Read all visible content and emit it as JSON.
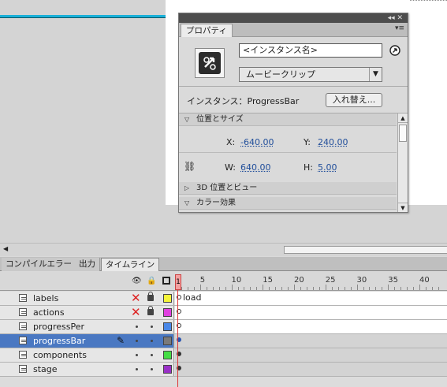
{
  "properties_panel": {
    "window_controls": "◂◂ ✕",
    "tab_label": "プロパティ",
    "menu_icon": "▾≡",
    "instance_name_placeholder": "<インスタンス名>",
    "symbol_type": "ムービークリップ",
    "instance_label": "インスタンス：ProgressBar",
    "swap_button": "入れ替え...",
    "position_size": {
      "title": "位置とサイズ",
      "x_label": "X:",
      "x_value": "-640.00",
      "y_label": "Y:",
      "y_value": "240.00",
      "w_label": "W:",
      "w_value": "640.00",
      "h_label": "H:",
      "h_value": "5.00"
    },
    "section_3d": "3D 位置とビュー",
    "section_color": "カラー効果"
  },
  "bottom_tabs": [
    "コンパイルエラー",
    "出力",
    "タイムライン"
  ],
  "timeline": {
    "frame_numbers": [
      "1",
      "5",
      "10",
      "15",
      "20",
      "25",
      "30",
      "35",
      "40"
    ],
    "current_frame": "1",
    "layers": [
      {
        "name": "labels",
        "color": "#f5f53a",
        "hidden": true,
        "locked": true,
        "frame_label": "load"
      },
      {
        "name": "actions",
        "color": "#e040e0",
        "hidden": true,
        "locked": true,
        "frame_label": ""
      },
      {
        "name": "progressPer",
        "color": "#4a88e8",
        "hidden": false,
        "locked": false,
        "frame_label": ""
      },
      {
        "name": "progressBar",
        "color": "#7a7a7a",
        "hidden": false,
        "locked": false,
        "frame_label": ""
      },
      {
        "name": "components",
        "color": "#44dd44",
        "hidden": false,
        "locked": false,
        "frame_label": ""
      },
      {
        "name": "stage",
        "color": "#9a30c8",
        "hidden": false,
        "locked": false,
        "frame_label": ""
      }
    ]
  }
}
